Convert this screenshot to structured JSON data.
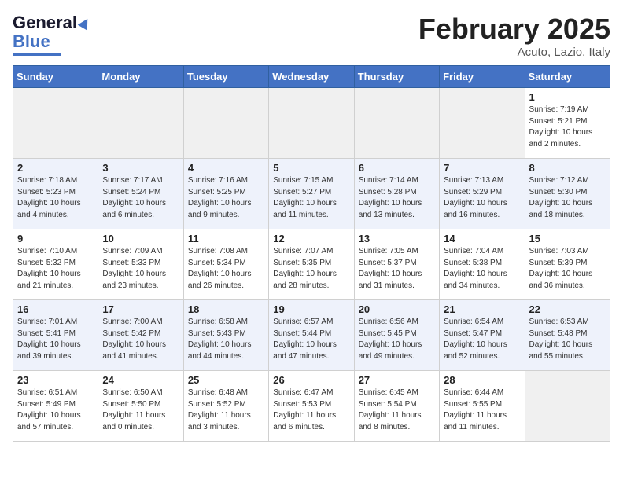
{
  "header": {
    "logo_line1": "General",
    "logo_line2": "Blue",
    "month": "February 2025",
    "location": "Acuto, Lazio, Italy"
  },
  "weekdays": [
    "Sunday",
    "Monday",
    "Tuesday",
    "Wednesday",
    "Thursday",
    "Friday",
    "Saturday"
  ],
  "weeks": [
    {
      "alt": false,
      "days": [
        {
          "num": "",
          "info": "",
          "empty": true
        },
        {
          "num": "",
          "info": "",
          "empty": true
        },
        {
          "num": "",
          "info": "",
          "empty": true
        },
        {
          "num": "",
          "info": "",
          "empty": true
        },
        {
          "num": "",
          "info": "",
          "empty": true
        },
        {
          "num": "",
          "info": "",
          "empty": true
        },
        {
          "num": "1",
          "info": "Sunrise: 7:19 AM\nSunset: 5:21 PM\nDaylight: 10 hours\nand 2 minutes.",
          "empty": false
        }
      ]
    },
    {
      "alt": true,
      "days": [
        {
          "num": "2",
          "info": "Sunrise: 7:18 AM\nSunset: 5:23 PM\nDaylight: 10 hours\nand 4 minutes.",
          "empty": false
        },
        {
          "num": "3",
          "info": "Sunrise: 7:17 AM\nSunset: 5:24 PM\nDaylight: 10 hours\nand 6 minutes.",
          "empty": false
        },
        {
          "num": "4",
          "info": "Sunrise: 7:16 AM\nSunset: 5:25 PM\nDaylight: 10 hours\nand 9 minutes.",
          "empty": false
        },
        {
          "num": "5",
          "info": "Sunrise: 7:15 AM\nSunset: 5:27 PM\nDaylight: 10 hours\nand 11 minutes.",
          "empty": false
        },
        {
          "num": "6",
          "info": "Sunrise: 7:14 AM\nSunset: 5:28 PM\nDaylight: 10 hours\nand 13 minutes.",
          "empty": false
        },
        {
          "num": "7",
          "info": "Sunrise: 7:13 AM\nSunset: 5:29 PM\nDaylight: 10 hours\nand 16 minutes.",
          "empty": false
        },
        {
          "num": "8",
          "info": "Sunrise: 7:12 AM\nSunset: 5:30 PM\nDaylight: 10 hours\nand 18 minutes.",
          "empty": false
        }
      ]
    },
    {
      "alt": false,
      "days": [
        {
          "num": "9",
          "info": "Sunrise: 7:10 AM\nSunset: 5:32 PM\nDaylight: 10 hours\nand 21 minutes.",
          "empty": false
        },
        {
          "num": "10",
          "info": "Sunrise: 7:09 AM\nSunset: 5:33 PM\nDaylight: 10 hours\nand 23 minutes.",
          "empty": false
        },
        {
          "num": "11",
          "info": "Sunrise: 7:08 AM\nSunset: 5:34 PM\nDaylight: 10 hours\nand 26 minutes.",
          "empty": false
        },
        {
          "num": "12",
          "info": "Sunrise: 7:07 AM\nSunset: 5:35 PM\nDaylight: 10 hours\nand 28 minutes.",
          "empty": false
        },
        {
          "num": "13",
          "info": "Sunrise: 7:05 AM\nSunset: 5:37 PM\nDaylight: 10 hours\nand 31 minutes.",
          "empty": false
        },
        {
          "num": "14",
          "info": "Sunrise: 7:04 AM\nSunset: 5:38 PM\nDaylight: 10 hours\nand 34 minutes.",
          "empty": false
        },
        {
          "num": "15",
          "info": "Sunrise: 7:03 AM\nSunset: 5:39 PM\nDaylight: 10 hours\nand 36 minutes.",
          "empty": false
        }
      ]
    },
    {
      "alt": true,
      "days": [
        {
          "num": "16",
          "info": "Sunrise: 7:01 AM\nSunset: 5:41 PM\nDaylight: 10 hours\nand 39 minutes.",
          "empty": false
        },
        {
          "num": "17",
          "info": "Sunrise: 7:00 AM\nSunset: 5:42 PM\nDaylight: 10 hours\nand 41 minutes.",
          "empty": false
        },
        {
          "num": "18",
          "info": "Sunrise: 6:58 AM\nSunset: 5:43 PM\nDaylight: 10 hours\nand 44 minutes.",
          "empty": false
        },
        {
          "num": "19",
          "info": "Sunrise: 6:57 AM\nSunset: 5:44 PM\nDaylight: 10 hours\nand 47 minutes.",
          "empty": false
        },
        {
          "num": "20",
          "info": "Sunrise: 6:56 AM\nSunset: 5:45 PM\nDaylight: 10 hours\nand 49 minutes.",
          "empty": false
        },
        {
          "num": "21",
          "info": "Sunrise: 6:54 AM\nSunset: 5:47 PM\nDaylight: 10 hours\nand 52 minutes.",
          "empty": false
        },
        {
          "num": "22",
          "info": "Sunrise: 6:53 AM\nSunset: 5:48 PM\nDaylight: 10 hours\nand 55 minutes.",
          "empty": false
        }
      ]
    },
    {
      "alt": false,
      "days": [
        {
          "num": "23",
          "info": "Sunrise: 6:51 AM\nSunset: 5:49 PM\nDaylight: 10 hours\nand 57 minutes.",
          "empty": false
        },
        {
          "num": "24",
          "info": "Sunrise: 6:50 AM\nSunset: 5:50 PM\nDaylight: 11 hours\nand 0 minutes.",
          "empty": false
        },
        {
          "num": "25",
          "info": "Sunrise: 6:48 AM\nSunset: 5:52 PM\nDaylight: 11 hours\nand 3 minutes.",
          "empty": false
        },
        {
          "num": "26",
          "info": "Sunrise: 6:47 AM\nSunset: 5:53 PM\nDaylight: 11 hours\nand 6 minutes.",
          "empty": false
        },
        {
          "num": "27",
          "info": "Sunrise: 6:45 AM\nSunset: 5:54 PM\nDaylight: 11 hours\nand 8 minutes.",
          "empty": false
        },
        {
          "num": "28",
          "info": "Sunrise: 6:44 AM\nSunset: 5:55 PM\nDaylight: 11 hours\nand 11 minutes.",
          "empty": false
        },
        {
          "num": "",
          "info": "",
          "empty": true
        }
      ]
    }
  ]
}
